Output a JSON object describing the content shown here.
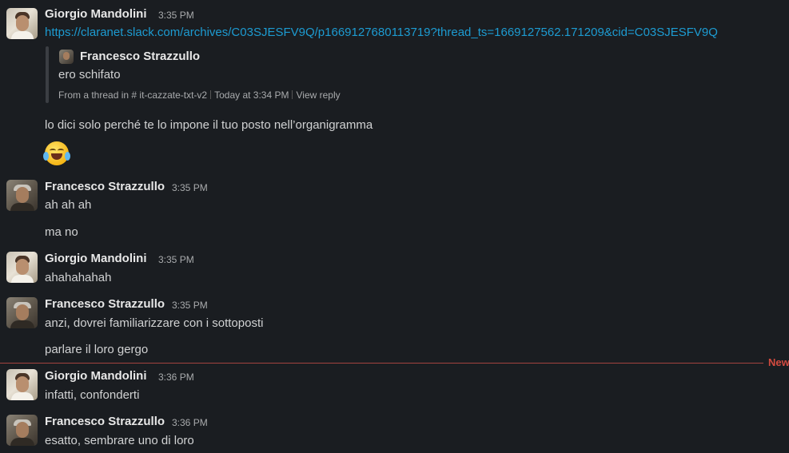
{
  "messages": [
    {
      "author": "Giorgio Mandolini",
      "time": "3:35 PM",
      "link": "https://claranet.slack.com/archives/C03SJESFV9Q/p1669127680113719?thread_ts=1669127562.171209&cid=C03SJESFV9Q",
      "quote": {
        "author": "Francesco Strazzullo",
        "text": "ero schifato",
        "from_thread": "From a thread in",
        "channel": "# it-cazzate-txt-v2",
        "date": "Today at 3:34 PM",
        "view_reply": "View reply"
      },
      "text": "lo dici solo perché te lo impone il tuo posto nell’organigramma",
      "emoji": "joy-emoji"
    },
    {
      "author": "Francesco Strazzullo",
      "time": "3:35 PM",
      "lines": [
        "ah ah ah",
        "ma no"
      ]
    },
    {
      "author": "Giorgio Mandolini",
      "time": "3:35 PM",
      "lines": [
        "ahahahahah"
      ]
    },
    {
      "author": "Francesco Strazzullo",
      "time": "3:35 PM",
      "lines": [
        "anzi, dovrei familiarizzare con i sottoposti",
        "parlare il loro gergo"
      ]
    },
    {
      "author": "Giorgio Mandolini",
      "time": "3:36 PM",
      "lines": [
        "infatti, confonderti"
      ]
    },
    {
      "author": "Francesco Strazzullo",
      "time": "3:36 PM",
      "lines": [
        "esatto, sembrare uno di loro"
      ]
    }
  ],
  "new_divider": "New",
  "colors": {
    "background": "#1a1d21",
    "link": "#1d9bd1",
    "new_divider": "#d34a3f"
  }
}
